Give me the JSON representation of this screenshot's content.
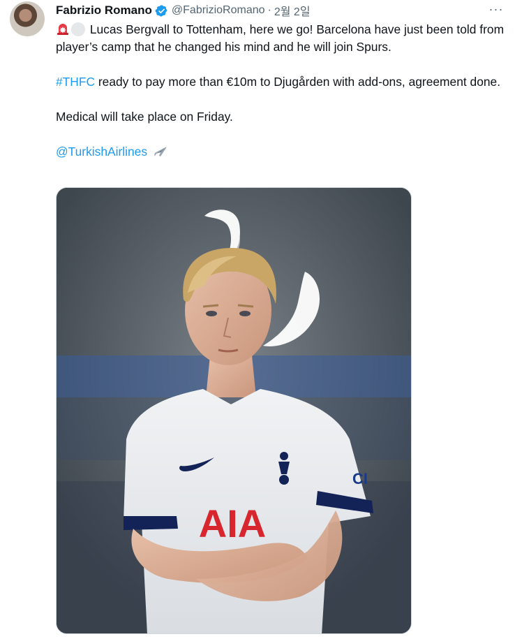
{
  "author": {
    "name": "Fabrizio Romano",
    "handle": "@FabrizioRomano",
    "separator": "·",
    "time": "2월 2일",
    "verified": true,
    "avatar_icon": "author-avatar"
  },
  "more_label": "···",
  "tweet": {
    "line1_text": " Lucas Bergvall to Tottenham, here we go! Barcelona have just been told from player’s camp that he changed his mind and he will join Spurs.",
    "hashtag": "#THFC",
    "line2_text": " ready to pay more than €10m to Djugården with add-ons, agreement done.",
    "line3_text": "Medical will take place on Friday.",
    "mention": "@TurkishAirlines",
    "icons": [
      "siren-icon",
      "white-circle-icon",
      "airplane-icon"
    ]
  },
  "media": {
    "shirt_sponsor": "AIA",
    "shirt_side_sponsor": "CI"
  },
  "colors": {
    "link": "#1d9bf0",
    "verified": "#1d9bf0",
    "secondary_text": "#536471"
  }
}
